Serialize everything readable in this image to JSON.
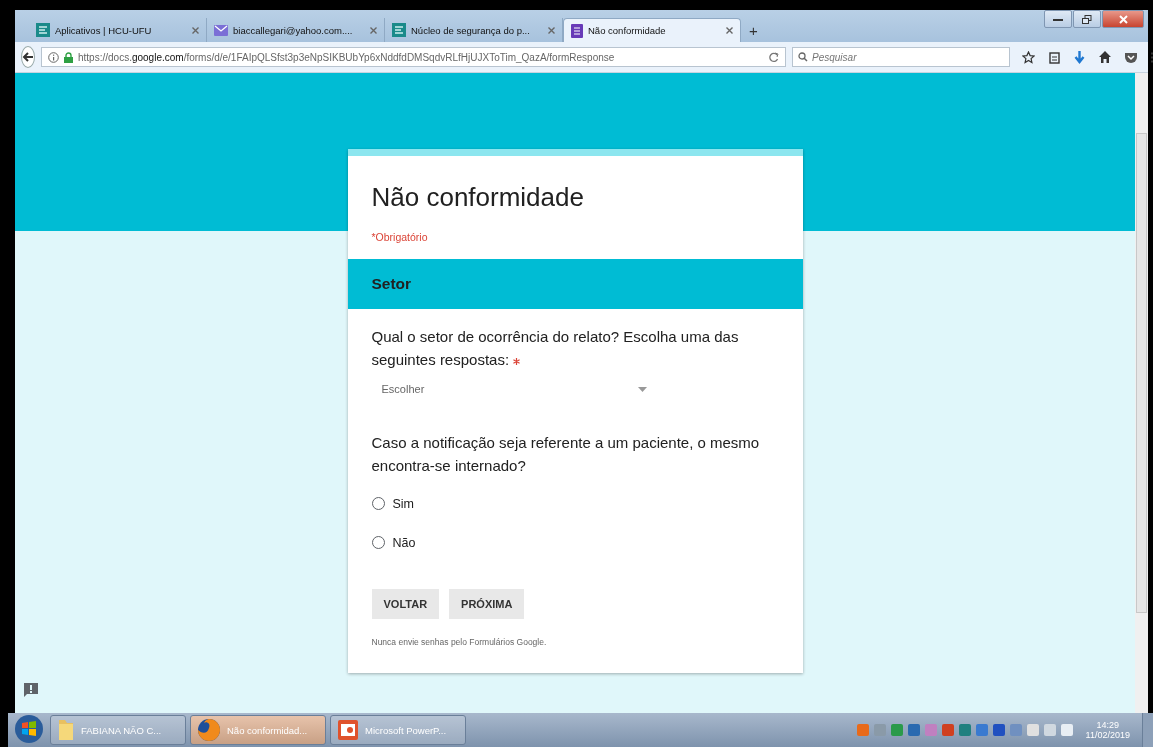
{
  "tabs": [
    {
      "label": "Aplicativos | HCU-UFU",
      "kind": "site",
      "selected": false
    },
    {
      "label": "biaccallegari@yahoo.com....",
      "kind": "mail",
      "selected": false
    },
    {
      "label": "Núcleo de segurança do p...",
      "kind": "site",
      "selected": false
    },
    {
      "label": "Não conformidade",
      "kind": "form",
      "selected": true
    }
  ],
  "new_tab": "+",
  "url": "https://docs.**google.com**/forms/d/e/1FAIpQLSfst3p3eNpSIKBUbYp6xNddfdDMSqdvRLfHjUJXToTim_QazA/formResponse",
  "search": {
    "placeholder": "Pesquisar"
  },
  "form": {
    "title": "Não conformidade",
    "required_note": "*Obrigatório",
    "section": "Setor",
    "questions": [
      {
        "kind": "dropdown",
        "text": "Qual o setor de ocorrência do relato? Escolha uma das seguintes respostas:",
        "required": true,
        "placeholder": "Escolher"
      },
      {
        "kind": "radio",
        "text": "Caso a notificação seja referente a um paciente, o mesmo encontra-se internado?",
        "required": false,
        "options": [
          {
            "label": "Sim",
            "selected": false
          },
          {
            "label": "Não",
            "selected": false
          }
        ]
      }
    ],
    "buttons": [
      "VOLTAR",
      "PRÓXIMA"
    ],
    "footer": "Nunca envie senhas pelo Formulários Google."
  },
  "taskbar": {
    "items": [
      {
        "label": "FABIANA NÃO C...",
        "kind": "folder",
        "selected": false
      },
      {
        "label": "Não conformidad...",
        "kind": "browser",
        "selected": true
      },
      {
        "label": "Microsoft PowerP...",
        "kind": "slides",
        "selected": false
      }
    ],
    "time": "14:29",
    "date": "11/02/2019"
  }
}
